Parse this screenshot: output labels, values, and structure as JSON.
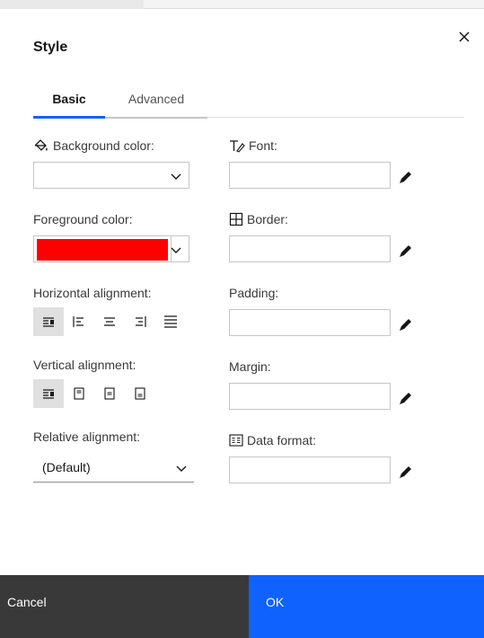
{
  "dialog": {
    "title": "Style",
    "close_icon": "close-icon"
  },
  "tabs": [
    {
      "label": "Basic",
      "selected": true
    },
    {
      "label": "Advanced",
      "selected": false
    }
  ],
  "left": {
    "background_color": {
      "label": "Background color:",
      "icon": "paint-bucket-icon",
      "value": ""
    },
    "foreground_color": {
      "label": "Foreground color:",
      "value": "#ff0000"
    },
    "horizontal_alignment": {
      "label": "Horizontal alignment:",
      "options": [
        "default-icon",
        "align-left-icon",
        "align-center-icon",
        "align-right-icon",
        "align-justify-icon"
      ],
      "selected": "default-icon"
    },
    "vertical_alignment": {
      "label": "Vertical alignment:",
      "options": [
        "default-icon",
        "align-top-icon",
        "align-middle-icon",
        "align-bottom-icon"
      ],
      "selected": "default-icon"
    },
    "relative_alignment": {
      "label": "Relative alignment:",
      "value": "(Default)"
    }
  },
  "right": {
    "font": {
      "label": "Font:",
      "icon": "text-font-icon",
      "value": ""
    },
    "border": {
      "label": "Border:",
      "icon": "border-grid-icon",
      "value": ""
    },
    "padding": {
      "label": "Padding:",
      "value": ""
    },
    "margin": {
      "label": "Margin:",
      "value": ""
    },
    "data_format": {
      "label": "Data format:",
      "icon": "data-format-icon",
      "value": ""
    },
    "edit_icon": "pencil-icon"
  },
  "footer": {
    "cancel_label": "Cancel",
    "ok_label": "OK"
  },
  "colors": {
    "primary": "#0f62fe",
    "secondary_button": "#393939",
    "foreground_swatch": "#ff0000"
  }
}
